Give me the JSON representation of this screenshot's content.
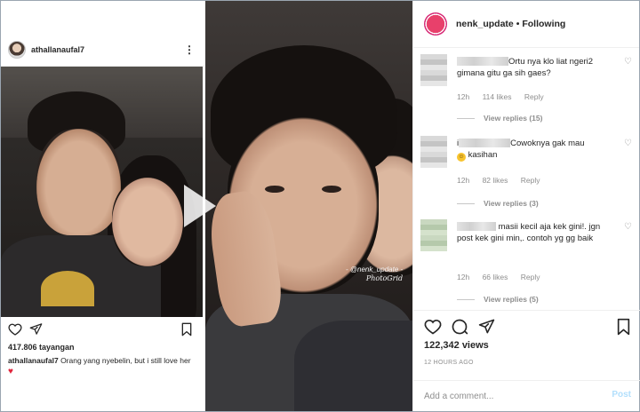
{
  "left_post": {
    "username": "athallanaufal7",
    "views": "417.806 tayangan",
    "caption_user": "athallanaufal7",
    "caption_text": "Orang yang nyebelin, but i still love her",
    "icons": [
      "heart-outline-icon",
      "send-icon",
      "bookmark-icon",
      "more-dots-icon",
      "play-icon"
    ]
  },
  "middle_photo": {
    "watermark_handle": "- @nenk_update -",
    "watermark_app": "PhotoGrid"
  },
  "right_panel": {
    "username": "nenk_update",
    "follow_status": "• Following",
    "comments": [
      {
        "text": "Ortu nya klo liat ngeri2 gimana gitu ga sih gaes?",
        "time": "12h",
        "likes": "114 likes",
        "reply": "Reply",
        "view_replies": "View replies (15)"
      },
      {
        "prefix": "i",
        "text": "Cowoknya gak mau",
        "text2": "kasihan",
        "time": "12h",
        "likes": "82 likes",
        "reply": "Reply",
        "view_replies": "View replies (3)"
      },
      {
        "text": "masii kecil aja kek gini!. jgn post kek gini min,. contoh yg gg baik",
        "time": "12h",
        "likes": "66 likes",
        "reply": "Reply",
        "view_replies": "View replies (5)"
      }
    ],
    "views": "122,342 views",
    "timestamp": "12 HOURS AGO",
    "add_comment_placeholder": "Add a comment...",
    "post_label": "Post"
  }
}
